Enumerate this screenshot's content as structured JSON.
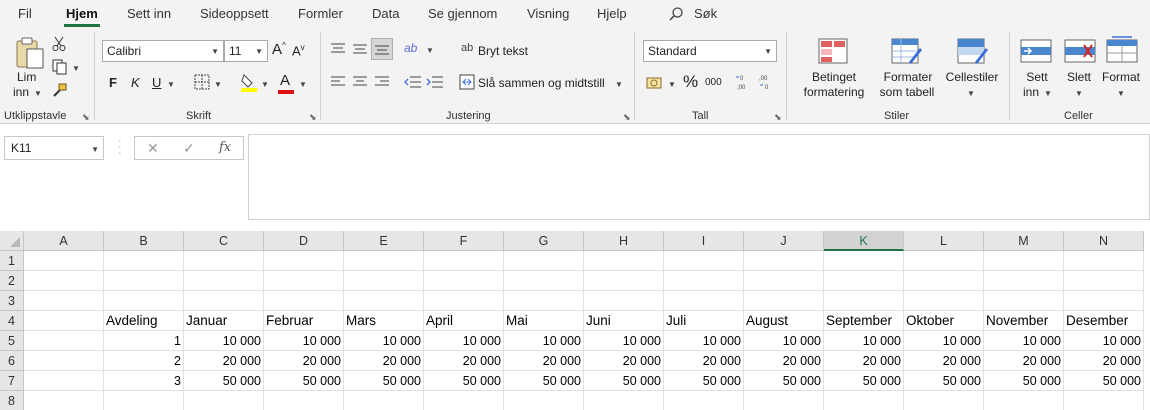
{
  "menu": {
    "tabs": [
      "Fil",
      "Hjem",
      "Sett inn",
      "Sideoppsett",
      "Formler",
      "Data",
      "Se gjennom",
      "Visning",
      "Hjelp"
    ],
    "active_tab": "Hjem",
    "search_label": "Søk"
  },
  "ribbon": {
    "clipboard": {
      "paste_label": "Lim",
      "paste_label2": "inn",
      "group": "Utklippstavle"
    },
    "font": {
      "name": "Calibri",
      "size": "11",
      "bold": "F",
      "italic": "K",
      "underline": "U",
      "group": "Skrift",
      "font_color": "#e01010",
      "fill_color": "#ffff00"
    },
    "alignment": {
      "wrap_text": "Bryt tekst",
      "merge_center": "Slå sammen og midtstill",
      "group": "Justering"
    },
    "number": {
      "format": "Standard",
      "group": "Tall",
      "percent": "%",
      "thousands": "000"
    },
    "styles": {
      "conditional": "Betinget",
      "conditional2": "formatering",
      "format_table": "Formater",
      "format_table2": "som tabell",
      "cell_styles": "Cellestiler",
      "group": "Stiler"
    },
    "cells": {
      "insert": "Sett",
      "insert2": "inn",
      "delete": "Slett",
      "format": "Format",
      "group": "Celler"
    }
  },
  "formula_bar": {
    "name_box": "K11",
    "cancel": "✕",
    "enter": "✓",
    "fx": "fx",
    "formula": ""
  },
  "sheet": {
    "columns": [
      "A",
      "B",
      "C",
      "D",
      "E",
      "F",
      "G",
      "H",
      "I",
      "J",
      "K",
      "L",
      "M",
      "N"
    ],
    "selected_column": "K",
    "rows": [
      "1",
      "2",
      "3",
      "4",
      "5",
      "6",
      "7",
      "8"
    ],
    "header_row": [
      "Avdeling",
      "Januar",
      "Februar",
      "Mars",
      "April",
      "Mai",
      "Juni",
      "Juli",
      "August",
      "September",
      "Oktober",
      "November",
      "Desember"
    ],
    "data_rows": [
      [
        "1",
        "10 000",
        "10 000",
        "10 000",
        "10 000",
        "10 000",
        "10 000",
        "10 000",
        "10 000",
        "10 000",
        "10 000",
        "10 000",
        "10 000"
      ],
      [
        "2",
        "20 000",
        "20 000",
        "20 000",
        "20 000",
        "20 000",
        "20 000",
        "20 000",
        "20 000",
        "20 000",
        "20 000",
        "20 000",
        "20 000"
      ],
      [
        "3",
        "50 000",
        "50 000",
        "50 000",
        "50 000",
        "50 000",
        "50 000",
        "50 000",
        "50 000",
        "50 000",
        "50 000",
        "50 000",
        "50 000"
      ]
    ]
  },
  "colors": {
    "accent": "#217346"
  }
}
